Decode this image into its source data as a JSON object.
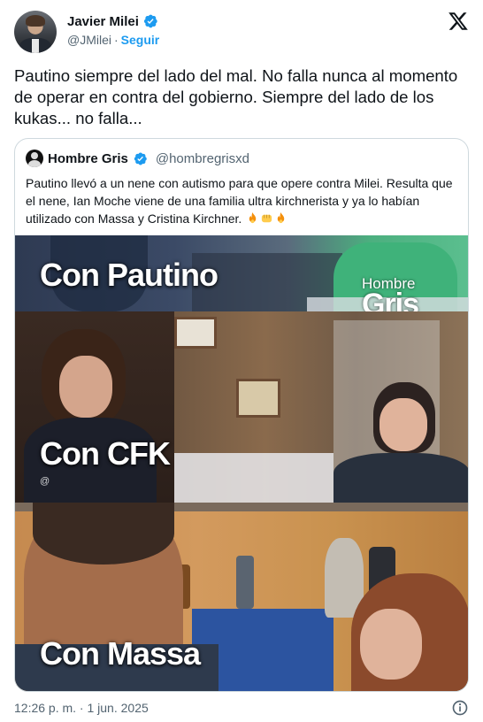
{
  "author": {
    "name": "Javier Milei",
    "handle": "@JMilei",
    "separator": "·",
    "follow_label": "Seguir"
  },
  "tweet": {
    "text": "Pautino siempre del lado del mal. No falla nunca al momento de operar en contra del gobierno. Siempre del lado de los kukas... no falla...",
    "timestamp": "12:26 p. m. · 1 jun. 2025"
  },
  "quoted": {
    "name": "Hombre Gris",
    "handle": "@hombregrisxd",
    "text": "Pautino llevó a un nene con autismo para  que opere contra Milei. Resulta que el nene, Ian Moche viene de una familia ultra kirchnerista y ya lo habían utilizado con Massa y Cristina Kirchner.",
    "emojis": [
      "fire-emoji",
      "fist-emoji",
      "fire-emoji"
    ],
    "media": {
      "panel_labels": [
        "Con Pautino",
        "Con CFK",
        "Con Massa"
      ],
      "watermark_top": "Hombre",
      "watermark_bottom": "Gris",
      "small_mark": "@"
    }
  },
  "colors": {
    "accent": "#1d9bf0",
    "text": "#0f1419",
    "secondary": "#536471",
    "border": "#cfd9de"
  },
  "icons": [
    "verified-badge-icon",
    "x-logo-icon",
    "info-icon"
  ]
}
